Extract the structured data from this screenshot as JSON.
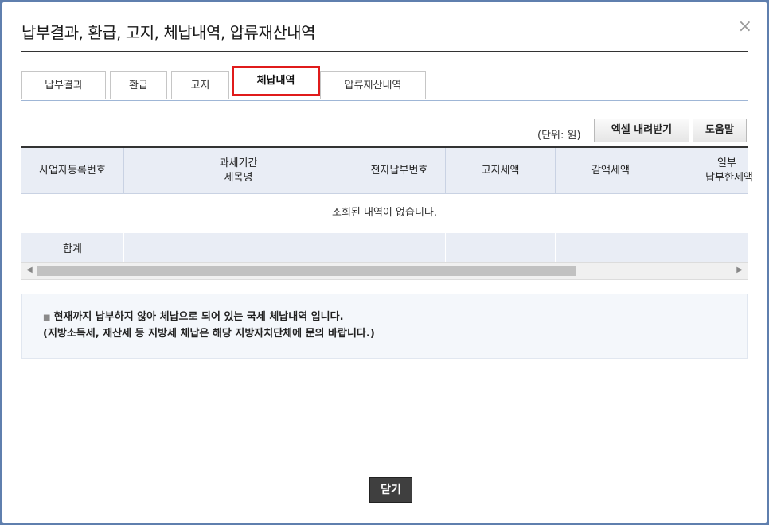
{
  "dialog": {
    "title": "납부결과, 환급, 고지, 체납내역, 압류재산내역",
    "close_icon": "×"
  },
  "tabs": [
    {
      "label": "납부결과",
      "active": false
    },
    {
      "label": "환급",
      "active": false
    },
    {
      "label": "고지",
      "active": false
    },
    {
      "label": "체납내역",
      "active": true
    },
    {
      "label": "압류재산내역",
      "active": false
    }
  ],
  "toolbar": {
    "unit": "(단위: 원)",
    "excel_label": "엑셀 내려받기",
    "help_label": "도움말"
  },
  "table": {
    "headers": [
      {
        "line1": "사업자등록번호",
        "line2": ""
      },
      {
        "line1": "과세기간",
        "line2": "세목명"
      },
      {
        "line1": "전자납부번호",
        "line2": ""
      },
      {
        "line1": "고지세액",
        "line2": ""
      },
      {
        "line1": "감액세액",
        "line2": ""
      },
      {
        "line1": "일부",
        "line2": "납부한세액"
      }
    ],
    "empty_message": "조회된 내역이 없습니다.",
    "total_label": "합계"
  },
  "notice": {
    "line1": "현재까지 납부하지 않아 체납으로 되어 있는 국세 체납내역 입니다.",
    "line2": "(지방소득세, 재산세 등 지방세 체납은 해당 지방자치단체에 문의 바랍니다.)"
  },
  "footer": {
    "close_label": "닫기"
  }
}
